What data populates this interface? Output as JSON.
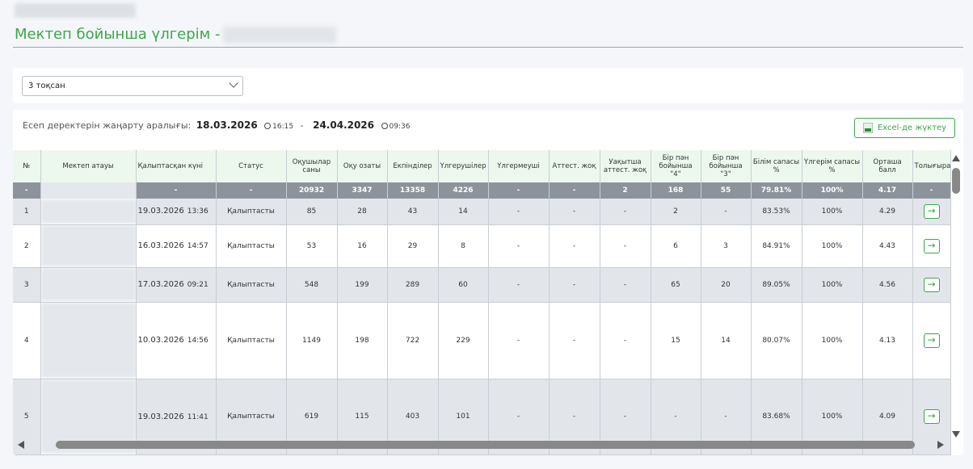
{
  "page": {
    "title": "Мектеп бойынша үлгерім -"
  },
  "filter": {
    "selected": "3 тоқсан"
  },
  "report": {
    "label": "Есеп деректерін жаңарту аралығы:",
    "from_date": "18.03.2026",
    "from_time": "16:15",
    "to_date": "24.04.2026",
    "to_time": "09:36",
    "excel_label": "Excel-де жүктеу"
  },
  "table": {
    "headers": [
      "№",
      "Мектеп атауы",
      "Қалыптасқан күні",
      "Статус",
      "Оқушылар саны",
      "Оқу озаты",
      "Екпінділер",
      "Үлгерушілер",
      "Үлгермеуші",
      "Аттест. жоқ",
      "Уақытша аттест. жоқ",
      "Бір пән бойынша \"4\"",
      "Бір пән бойынша \"3\"",
      "Білім сапасы %",
      "Үлгерім сапасы %",
      "Орташа балл",
      "Толығырақ"
    ],
    "total": [
      "-",
      "",
      "-",
      "-",
      "20932",
      "3347",
      "13358",
      "4226",
      "-",
      "-",
      "2",
      "168",
      "55",
      "79.81%",
      "100%",
      "4.17",
      "-"
    ],
    "rows": [
      {
        "no": "1",
        "date": "19.03.2026",
        "time": "13:36",
        "status": "Қалыптасты",
        "students": "85",
        "excellent": "28",
        "good": "43",
        "passing": "14",
        "failing": "-",
        "no_att": "-",
        "temp_no_att": "-",
        "one4": "2",
        "one3": "-",
        "quality": "83.53%",
        "progress": "100%",
        "avg": "4.29"
      },
      {
        "no": "2",
        "date": "16.03.2026",
        "time": "14:57",
        "status": "Қалыптасты",
        "students": "53",
        "excellent": "16",
        "good": "29",
        "passing": "8",
        "failing": "-",
        "no_att": "-",
        "temp_no_att": "-",
        "one4": "6",
        "one3": "3",
        "quality": "84.91%",
        "progress": "100%",
        "avg": "4.43"
      },
      {
        "no": "3",
        "date": "17.03.2026",
        "time": "09:21",
        "status": "Қалыптасты",
        "students": "548",
        "excellent": "199",
        "good": "289",
        "passing": "60",
        "failing": "-",
        "no_att": "-",
        "temp_no_att": "-",
        "one4": "65",
        "one3": "20",
        "quality": "89.05%",
        "progress": "100%",
        "avg": "4.56"
      },
      {
        "no": "4",
        "date": "10.03.2026",
        "time": "14:56",
        "status": "Қалыптасты",
        "students": "1149",
        "excellent": "198",
        "good": "722",
        "passing": "229",
        "failing": "-",
        "no_att": "-",
        "temp_no_att": "-",
        "one4": "15",
        "one3": "14",
        "quality": "80.07%",
        "progress": "100%",
        "avg": "4.13"
      },
      {
        "no": "5",
        "date": "19.03.2026",
        "time": "11:41",
        "status": "Қалыптасты",
        "students": "619",
        "excellent": "115",
        "good": "403",
        "passing": "101",
        "failing": "-",
        "no_att": "-",
        "temp_no_att": "-",
        "one4": "-",
        "one3": "-",
        "quality": "83.68%",
        "progress": "100%",
        "avg": "4.09"
      }
    ]
  },
  "colors": {
    "accent": "#3aa84a",
    "header_bg": "#ecf8ee",
    "total_bg": "#8c939b"
  },
  "icons": {
    "details": "arrow-right-icon",
    "excel": "excel-file-icon",
    "clock": "clock-icon"
  }
}
